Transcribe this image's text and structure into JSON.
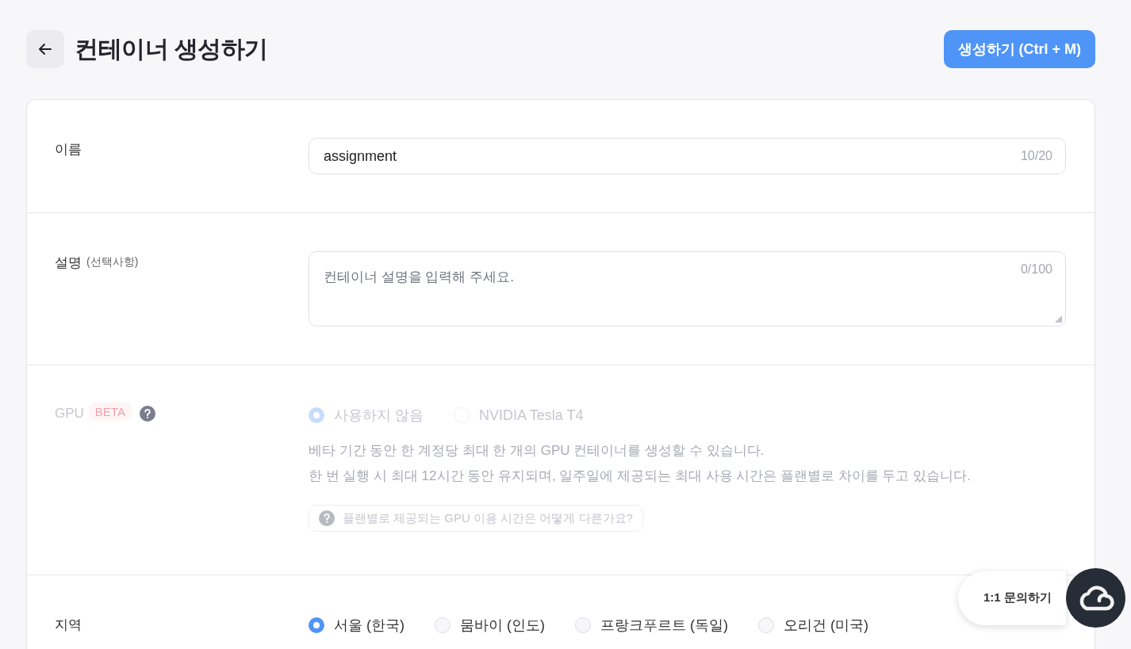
{
  "header": {
    "title": "컨테이너 생성하기",
    "create_button": "생성하기 (Ctrl + M)"
  },
  "form": {
    "sections": [
      {
        "kind": "text",
        "label": "이름",
        "value": "assignment",
        "counter": "10/20"
      },
      {
        "kind": "textarea",
        "label": "설명",
        "optional_note": "(선택사항)",
        "placeholder": "컨테이너 설명을 입력해 주세요.",
        "counter": "0/100"
      },
      {
        "kind": "radio",
        "label": "GPU",
        "badge": "BETA",
        "info_icon": true,
        "disabled": true,
        "options": [
          {
            "label": "사용하지 않음",
            "selected": true
          },
          {
            "label": "NVIDIA Tesla T4",
            "selected": false
          }
        ],
        "notes": [
          "베타 기간 동안 한 계정당 최대 한 개의 GPU 컨테이너를 생성할 수 있습니다.",
          "한 번 실행 시 최대 12시간 동안 유지되며, 일주일에 제공되는 최대 사용 시간은 플랜별로 차이를 두고 있습니다."
        ],
        "help_link": "플랜별로 제공되는 GPU 이용 시간은 어떻게 다른가요?"
      },
      {
        "kind": "radio",
        "label": "지역",
        "disabled": false,
        "options": [
          {
            "label": "서울 (한국)",
            "selected": true
          },
          {
            "label": "뭄바이 (인도)",
            "selected": false
          },
          {
            "label": "프랑크푸르트 (독일)",
            "selected": false
          },
          {
            "label": "오리건 (미국)",
            "selected": false
          }
        ]
      }
    ]
  },
  "chat_widget": {
    "label": "1:1 문의하기"
  }
}
